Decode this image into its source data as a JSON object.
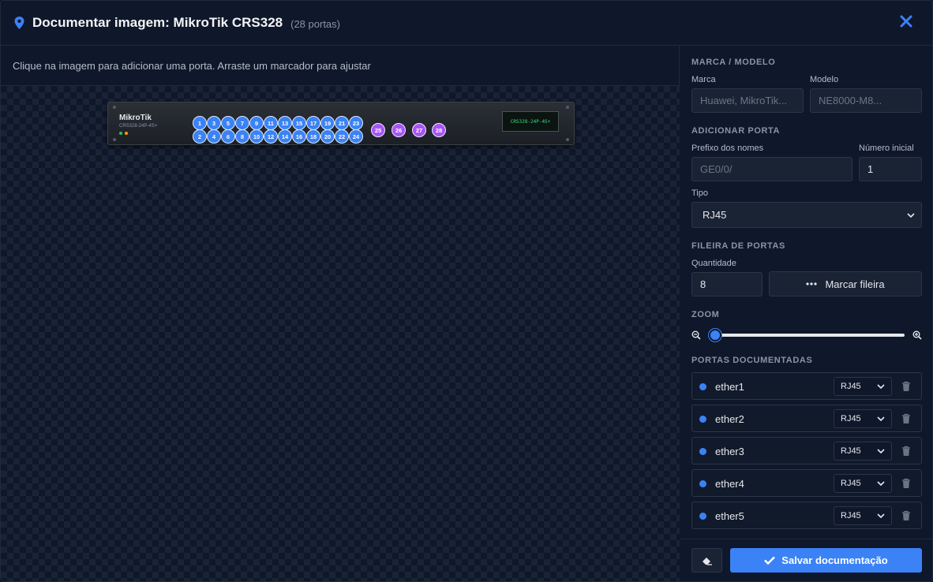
{
  "header": {
    "title": "Documentar imagem: MikroTik CRS328",
    "subtitle": "(28 portas)"
  },
  "hint": "Clique na imagem para adicionar uma porta. Arraste um marcador para ajustar",
  "device": {
    "brand": "MikroTik",
    "model": "CRS328-24P-4S+",
    "lcd": "CRS328-24P-4S+"
  },
  "markers": {
    "rj45": [
      "1",
      "2",
      "3",
      "4",
      "5",
      "6",
      "7",
      "8",
      "9",
      "10",
      "11",
      "12",
      "13",
      "14",
      "15",
      "16",
      "17",
      "18",
      "19",
      "20",
      "21",
      "22",
      "23",
      "24"
    ],
    "sfp": [
      "25",
      "26",
      "27",
      "28"
    ]
  },
  "sections": {
    "brand_model": "MARCA / MODELO",
    "add_port": "ADICIONAR PORTA",
    "port_row": "FILEIRA DE PORTAS",
    "zoom": "ZOOM",
    "documented": "PORTAS DOCUMENTADAS"
  },
  "form": {
    "brand_label": "Marca",
    "brand_placeholder": "Huawei, MikroTik...",
    "model_label": "Modelo",
    "model_placeholder": "NE8000-M8...",
    "prefix_label": "Prefixo dos nomes",
    "prefix_placeholder": "GE0/0/",
    "start_label": "Número inicial",
    "start_value": "1",
    "type_label": "Tipo",
    "type_value": "RJ45",
    "qty_label": "Quantidade",
    "qty_value": "8",
    "mark_row_button": "Marcar fileira",
    "zoom_level": 0
  },
  "ports": [
    {
      "name": "ether1",
      "type": "RJ45"
    },
    {
      "name": "ether2",
      "type": "RJ45"
    },
    {
      "name": "ether3",
      "type": "RJ45"
    },
    {
      "name": "ether4",
      "type": "RJ45"
    },
    {
      "name": "ether5",
      "type": "RJ45"
    }
  ],
  "footer": {
    "save_label": "Salvar documentação"
  },
  "colors": {
    "accent": "#3b82f6",
    "sfp": "#a855f7",
    "lcd_text": "#3ddc84"
  }
}
